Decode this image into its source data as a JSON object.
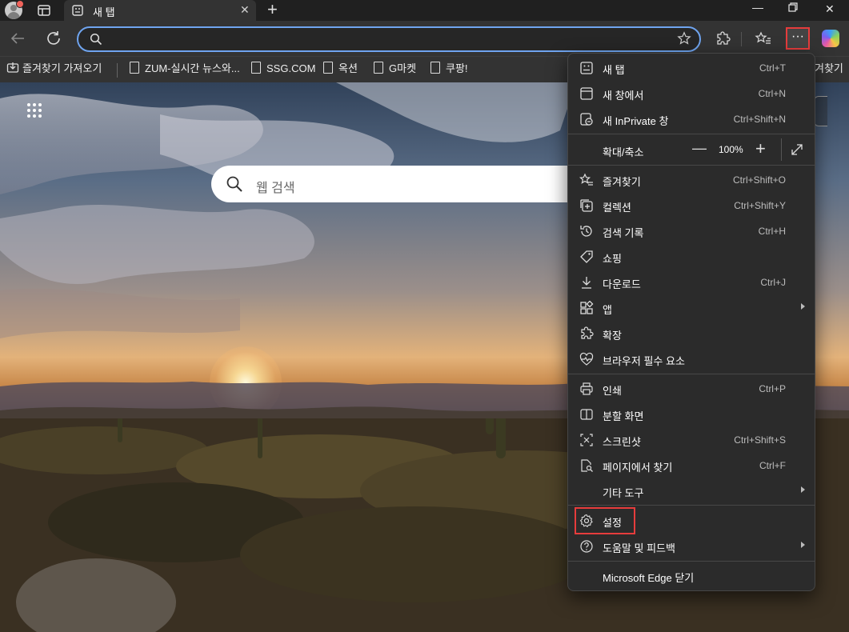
{
  "tab": {
    "title": "새 탭"
  },
  "search": {
    "placeholder": "웹 검색"
  },
  "favorites": [
    {
      "label": "즐겨찾기 가져오기"
    },
    {
      "label": "ZUM-실시간 뉴스와..."
    },
    {
      "label": "SSG.COM"
    },
    {
      "label": "옥션"
    },
    {
      "label": "G마켓"
    },
    {
      "label": "쿠팡!"
    }
  ],
  "favorites_overflow": "겨찾기",
  "menu": {
    "new_tab": {
      "label": "새 탭",
      "shortcut": "Ctrl+T"
    },
    "new_window": {
      "label": "새 창에서",
      "shortcut": "Ctrl+N"
    },
    "new_inprivate": {
      "label": "새 InPrivate 창",
      "shortcut": "Ctrl+Shift+N"
    },
    "zoom": {
      "label": "확대/축소",
      "value": "100%"
    },
    "favorites": {
      "label": "즐겨찾기",
      "shortcut": "Ctrl+Shift+O"
    },
    "collections": {
      "label": "컬렉션",
      "shortcut": "Ctrl+Shift+Y"
    },
    "history": {
      "label": "검색 기록",
      "shortcut": "Ctrl+H"
    },
    "shopping": {
      "label": "쇼핑"
    },
    "downloads": {
      "label": "다운로드",
      "shortcut": "Ctrl+J"
    },
    "apps": {
      "label": "앱"
    },
    "extensions": {
      "label": "확장"
    },
    "essentials": {
      "label": "브라우저 필수 요소"
    },
    "print": {
      "label": "인쇄",
      "shortcut": "Ctrl+P"
    },
    "split": {
      "label": "분할 화면"
    },
    "screenshot": {
      "label": "스크린샷",
      "shortcut": "Ctrl+Shift+S"
    },
    "find": {
      "label": "페이지에서 찾기",
      "shortcut": "Ctrl+F"
    },
    "more_tools": {
      "label": "기타 도구"
    },
    "settings": {
      "label": "설정"
    },
    "help": {
      "label": "도움말 및 피드백"
    },
    "close": {
      "label": "Microsoft Edge 닫기"
    }
  },
  "colors": {
    "highlight": "#e63c3c",
    "address_border": "#6fa4ef",
    "menu_bg": "#2b2b2b"
  }
}
